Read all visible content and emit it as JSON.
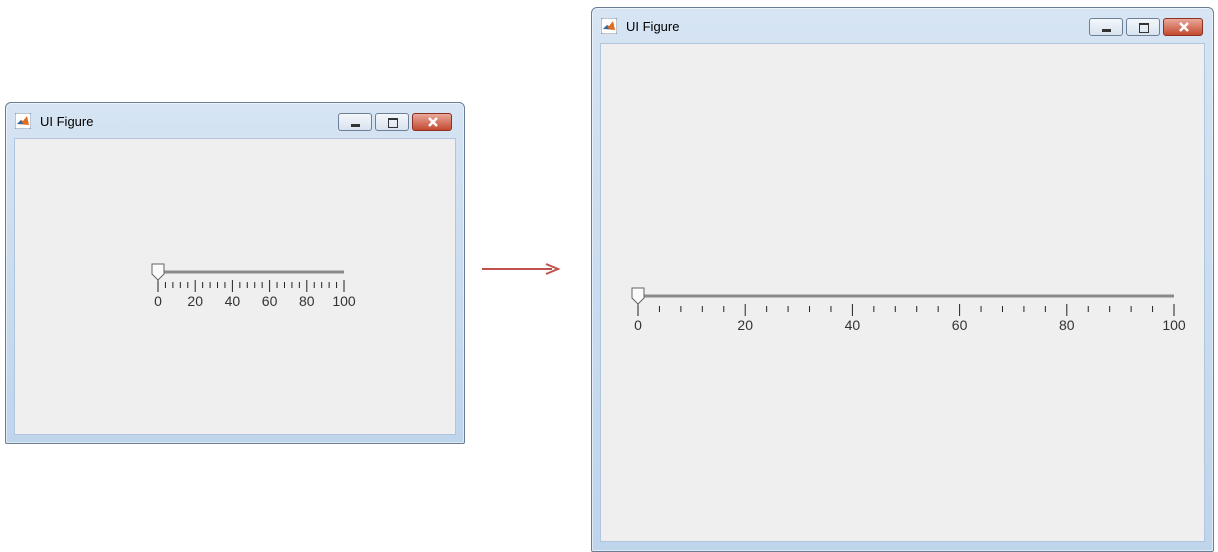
{
  "left_window": {
    "title": "UI Figure"
  },
  "right_window": {
    "title": "UI Figure"
  },
  "slider": {
    "min": 0,
    "max": 100,
    "value": 0,
    "major_ticks": [
      "0",
      "20",
      "40",
      "60",
      "80",
      "100"
    ]
  },
  "colors": {
    "arrow": "#c0504d",
    "close_button": "#c44a30",
    "track": "#8a8a8a"
  },
  "icons": {
    "app": "matlab-logo-icon",
    "minimize": "minimize-icon",
    "maximize": "maximize-icon",
    "close": "close-icon"
  }
}
